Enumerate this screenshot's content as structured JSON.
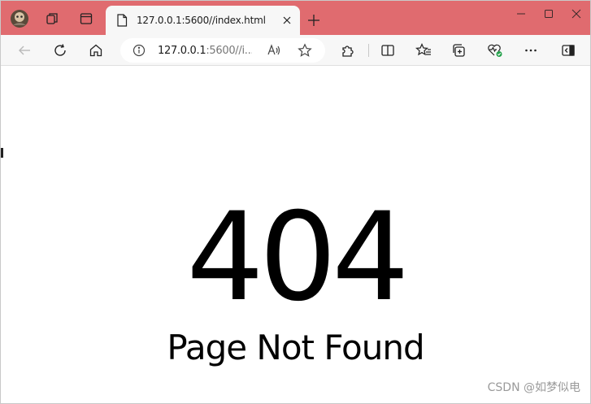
{
  "browser": {
    "accent_color": "#e06b6f",
    "tab": {
      "title": "127.0.0.1:5600//index.html",
      "icon": "page-icon"
    },
    "address": {
      "host": "127.0.0.1",
      "path": ":5600//i..."
    }
  },
  "page": {
    "error_code": "404",
    "message": "Page Not Found"
  },
  "watermark": "CSDN @如梦似电"
}
